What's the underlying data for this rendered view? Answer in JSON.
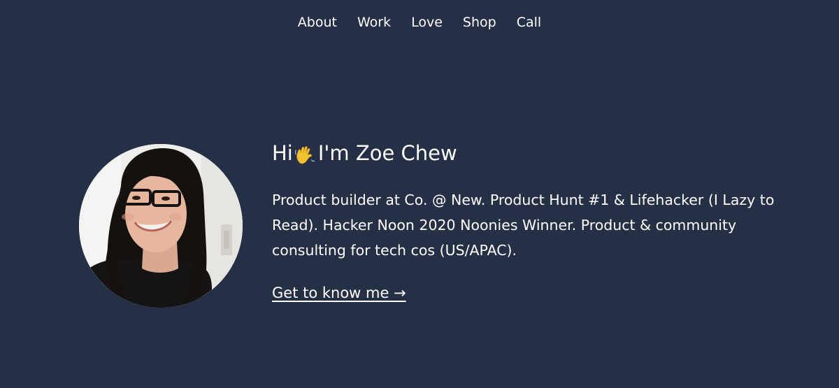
{
  "nav": {
    "items": [
      {
        "label": "About"
      },
      {
        "label": "Work"
      },
      {
        "label": "Love"
      },
      {
        "label": "Shop"
      },
      {
        "label": "Call"
      }
    ]
  },
  "hero": {
    "greeting_hi": "Hi",
    "greeting_name": "I'm Zoe Chew",
    "wave_icon": "waving-hand-icon",
    "bio": "Product builder at Co. @ New. Product Hunt #1 & Lifehacker (I Lazy to Read). Hacker Noon 2020 Noonies Winner. Product & community consulting for tech cos (US/APAC).",
    "cta_label": "Get to know me →"
  },
  "colors": {
    "background": "#252f46",
    "text": "#ffffff"
  }
}
